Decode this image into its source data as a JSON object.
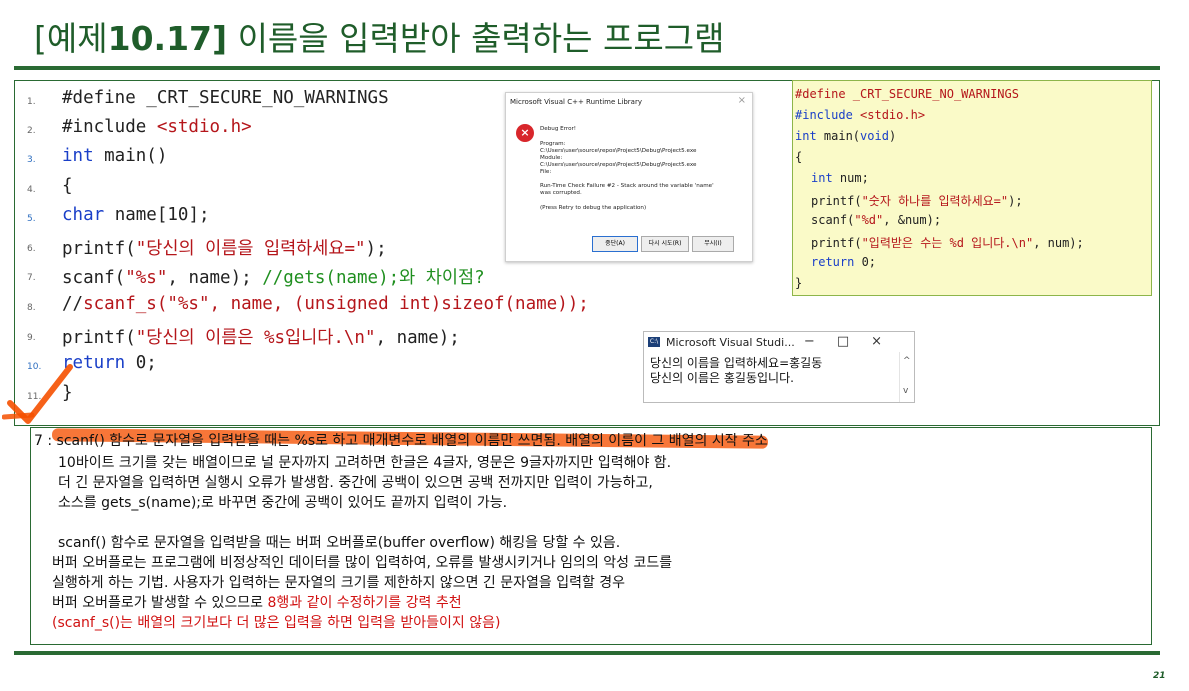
{
  "title": {
    "prefix": "[예제",
    "number": "10.17]",
    "rest": " 이름을 입력받아 출력하는 프로그램"
  },
  "code": {
    "line_numbers": [
      "1.",
      "2.",
      "3.",
      "4.",
      "5.",
      "6.",
      "7.",
      "8.",
      "9.",
      "10.",
      "11."
    ],
    "l1": "#define _CRT_SECURE_NO_WARNINGS",
    "l2a": "#include ",
    "l2b": "<stdio.h>",
    "l3a": "int",
    "l3b": " main()",
    "l4": "{",
    "l5a": " char",
    "l5b": " name[10];",
    "l6a": " printf(",
    "l6b": "\"당신의 이름을 입력하세요=\"",
    "l6c": ");",
    "l7a": " scanf(",
    "l7b": "\"%s\"",
    "l7c": ", name); ",
    "l7d": "//gets(name);와 차이점?",
    "l8a": "//",
    "l8b": "scanf_s(\"%s\", name, (unsigned int)sizeof(name));",
    "l9a": " printf(",
    "l9b": "\"당신의 이름은 %s입니다.\\n\"",
    "l9c": ", name);",
    "l10a": " return",
    "l10b": " 0;",
    "l11": "}"
  },
  "dialog": {
    "title": "Microsoft Visual C++ Runtime Library",
    "close": "×",
    "error_glyph": "×",
    "heading": "Debug Error!",
    "lines": [
      "Program:",
      "C:\\Users\\user\\source\\repos\\Project5\\Debug\\Project5.exe",
      "Module:",
      "C:\\Users\\user\\source\\repos\\Project5\\Debug\\Project5.exe",
      "File:",
      "",
      "Run-Time Check Failure #2 - Stack around the variable 'name'",
      "was corrupted.",
      "",
      "(Press Retry to debug the application)"
    ],
    "btn_abort": "중단(A)",
    "btn_retry": "다시 시도(R)",
    "btn_ignore": "무시(I)"
  },
  "vs_code": {
    "l1": "#define _CRT_SECURE_NO_WARNINGS",
    "l2a": "#include ",
    "l2b": "<stdio.h>",
    "l3a": "int",
    "l3b": " main(",
    "l3c": "void",
    "l3d": ")",
    "l4": "{",
    "l5a": "int",
    "l5b": " num;",
    "l6a": "printf(",
    "l6b": "\"숫자 하나를 입력하세요=\"",
    "l6c": ");",
    "l7a": "scanf(",
    "l7b": "\"%d\"",
    "l7c": ", &num);",
    "l8a": "printf(",
    "l8b": "\"입력받은 수는 %d 입니다.\\n\"",
    "l8c": ", num);",
    "l9a": "return",
    "l9b": " 0;",
    "l10": "}"
  },
  "console": {
    "icon_text": "C:\\",
    "title": "Microsoft Visual Studi...",
    "window_buttons": "−□×",
    "out1": "당신의 이름을 입력하세요=홍길동",
    "out2": "당신의 이름은 홍길동입니다.",
    "scroll_up": "^",
    "scroll_down": "v"
  },
  "notes": {
    "n1": "7 : scanf() 함수로 문자열을 입력받을 때는 %s로 하고 매개변수로 배열의 이름만 쓰면됨. 배열의 이름이 그 배열의 시작 주소",
    "n2": "10바이트 크기를 갖는 배열이므로 널 문자까지 고려하면 한글은 4글자, 영문은 9글자까지만 입력해야 함.",
    "n3": "더 긴 문자열을 입력하면 실행시 오류가 발생함. 중간에 공백이 있으면 공백 전까지만 입력이 가능하고,",
    "n4": "소스를 gets_s(name);로 바꾸면 중간에 공백이 있어도 끝까지 입력이 가능.",
    "n5": "scanf() 함수로 문자열을 입력받을 때는 버퍼 오버플로(buffer overflow) 해킹을 당할 수 있음.",
    "n6": "버퍼 오버플로는 프로그램에 비정상적인 데이터를 많이 입력하여, 오류를 발생시키거나 임의의 악성 코드를",
    "n7": "실행하게 하는 기법. 사용자가 입력하는 문자열의 크기를 제한하지 않으면 긴 문자열을 입력할 경우",
    "n8a": "버퍼 오버플로가 발생할 수 있으므로 ",
    "n8b": "8행과 같이 수정하기를 강력 추천",
    "n9": "(scanf_s()는 배열의 크기보다 더 많은 입력을 하면 입력을 받아들이지 않음)"
  },
  "page_number": "21",
  "colors": {
    "title": "#1f5d2a",
    "rule": "#2a6a33",
    "keyword": "#1a3fc8",
    "string": "#b5161b",
    "comment": "#1f8f1f",
    "highlight": "#f55000",
    "note_red": "#d11212"
  }
}
